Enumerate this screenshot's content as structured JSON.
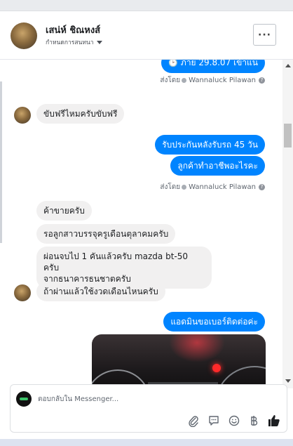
{
  "header": {
    "name": "เสน่ห์ ชิณหงส์",
    "subtitle": "กำหนดการสนทนา",
    "more_label": "···"
  },
  "messages": {
    "top_bubble_partial": "ภาย 29.8.07 เข้าแน",
    "sent_by_prefix": "ส่งโดย",
    "sent_by_name": "Wannaluck Pilawan",
    "in1": "ขับฟรีไหมครับขับฟรี",
    "out1": "รับประกันหลังรับรถ 45 วัน",
    "out2": "ลูกค้าทำอาชีพอะไรคะ",
    "in2": "ค้าขายครับ",
    "in3": "รอลูกสาวบรรจุครูเดือนตุลาคมครับ",
    "in4_line1": "ผ่อนจบไป 1 คันแล้วครับ mazda bt-50 ครับ",
    "in4_line2": "จากธนาคารธนชาตครับ",
    "in5": "ถ้าผ่านแล้วใช้งวดเดือนไหนครับ",
    "out3": "แอดมินขอเบอร์ติดต่อค่ะ"
  },
  "composer": {
    "placeholder": "ตอบกลับใน Messenger..."
  },
  "colors": {
    "outgoing": "#0084ff",
    "incoming": "#f1f0f0",
    "like": "#1c1e21"
  },
  "icons": [
    "paperclip-icon",
    "speech-bubble-icon",
    "emoji-icon",
    "baht-icon",
    "thumbs-up-icon",
    "kebab-more-icon"
  ]
}
